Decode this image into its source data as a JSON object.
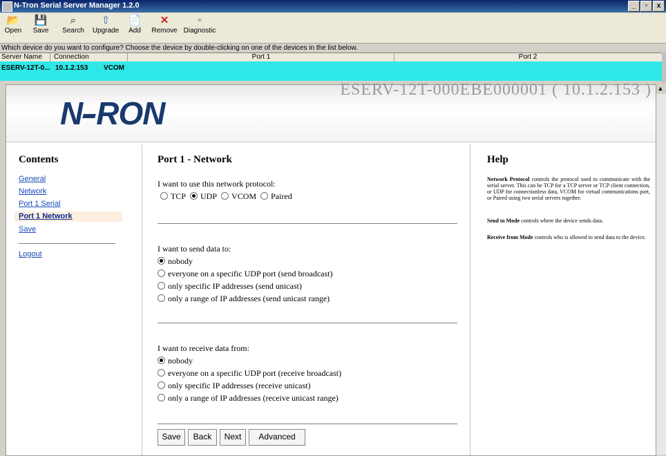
{
  "window": {
    "title": "N-Tron Serial Server Manager 1.2.0",
    "controls": [
      "_",
      "▫",
      "x"
    ]
  },
  "toolbar": {
    "buttons": [
      {
        "label": "Open",
        "icon": "open-folder-icon"
      },
      {
        "label": "Save",
        "icon": "floppy-disk-icon"
      },
      {
        "label": "Search",
        "icon": "search-icon"
      },
      {
        "label": "Upgrade",
        "icon": "upgrade-icon"
      },
      {
        "label": "Add",
        "icon": "add-document-icon"
      },
      {
        "label": "Remove",
        "icon": "remove-x-icon"
      },
      {
        "label": "Diagnostic",
        "icon": "diagnostic-icon"
      }
    ]
  },
  "prompt": "Which device do you want to configure? Choose the device by double-clicking on one of the devices in the list below.",
  "device_list": {
    "columns": [
      "Server Name",
      "Connection",
      "Port 1",
      "Port 2"
    ],
    "rows": [
      {
        "server_name": "ESERV-12T-0...",
        "connection": "10.1.2.153",
        "port1": "VCOM",
        "port2": ""
      }
    ]
  },
  "page": {
    "device_title": "ESERV-12T-000EBE000001 ( 10.1.2.153 )",
    "logo": {
      "left": "N",
      "right": "RON"
    },
    "nav": {
      "heading": "Contents",
      "links": [
        "General",
        "Network",
        "Port 1 Serial",
        "Port 1 Network",
        "Save",
        "Logout"
      ],
      "active": "Port 1 Network"
    },
    "main": {
      "heading": "Port 1 - Network",
      "protocol_question": "I want to use this network protocol:",
      "protocols": [
        "TCP",
        "UDP",
        "VCOM",
        "Paired"
      ],
      "protocol_selected": "UDP",
      "send_question": "I want to send data to:",
      "send_options": [
        "nobody",
        "everyone on a specific UDP port (send broadcast)",
        "only specific IP addresses (send unicast)",
        "only a range of IP addresses (send unicast range)"
      ],
      "send_selected": "nobody",
      "receive_question": "I want to receive data from:",
      "receive_options": [
        "nobody",
        "everyone on a specific UDP port (receive broadcast)",
        "only specific IP addresses (receive unicast)",
        "only a range of IP addresses (receive unicast range)"
      ],
      "receive_selected": "nobody",
      "buttons": {
        "save": "Save",
        "back": "Back",
        "next": "Next",
        "advanced": "Advanced"
      }
    },
    "help": {
      "heading": "Help",
      "paragraphs": [
        {
          "term": "Network Protocol",
          "text": " controls the protocol used to communicate with the serial server. This can be TCP for a TCP server or TCP client connection, or UDP for connectionless data, VCOM for virtual communications port, or Paired using two serial servers together."
        },
        {
          "term": "Send to Mode",
          "text": " controls where the device sends data."
        },
        {
          "term": "Receive from Mode",
          "text": " controls who is allowed to send data to the device."
        }
      ]
    }
  },
  "colors": {
    "selected_row": "#2ee8e8",
    "logo": "#1a3a6e",
    "link": "#1a4ab8",
    "active_nav": "#fdeee0"
  }
}
